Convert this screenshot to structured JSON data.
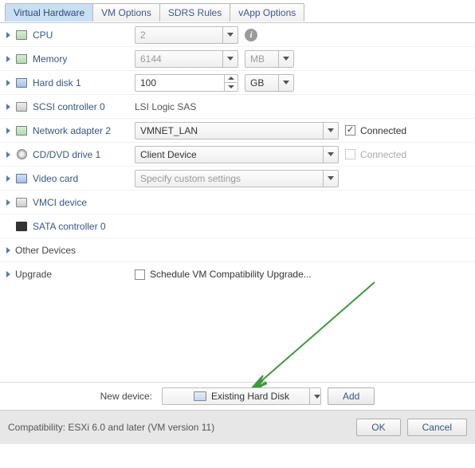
{
  "tabs": [
    "Virtual Hardware",
    "VM Options",
    "SDRS Rules",
    "vApp Options"
  ],
  "rows": {
    "cpu": {
      "label": "CPU",
      "value": "2"
    },
    "memory": {
      "label": "Memory",
      "value": "6144",
      "unit": "MB"
    },
    "harddisk1": {
      "label": "Hard disk 1",
      "value": "100",
      "unit": "GB"
    },
    "scsi": {
      "label": "SCSI controller 0",
      "value": "LSI Logic SAS"
    },
    "net2": {
      "label": "Network adapter 2",
      "value": "VMNET_LAN",
      "connected_label": "Connected"
    },
    "cddvd": {
      "label": "CD/DVD drive 1",
      "value": "Client Device",
      "connected_label": "Connected"
    },
    "video": {
      "label": "Video card",
      "value": "Specify custom settings"
    },
    "vmci": {
      "label": "VMCI device"
    },
    "sata": {
      "label": "SATA controller 0"
    },
    "other": {
      "label": "Other Devices"
    },
    "upgrade": {
      "label": "Upgrade",
      "checkbox_label": "Schedule VM Compatibility Upgrade..."
    }
  },
  "new_device": {
    "label": "New device:",
    "value": "Existing Hard Disk",
    "add_label": "Add"
  },
  "compatibility": "Compatibility: ESXi 6.0 and later (VM version 11)",
  "buttons": {
    "ok": "OK",
    "cancel": "Cancel"
  }
}
